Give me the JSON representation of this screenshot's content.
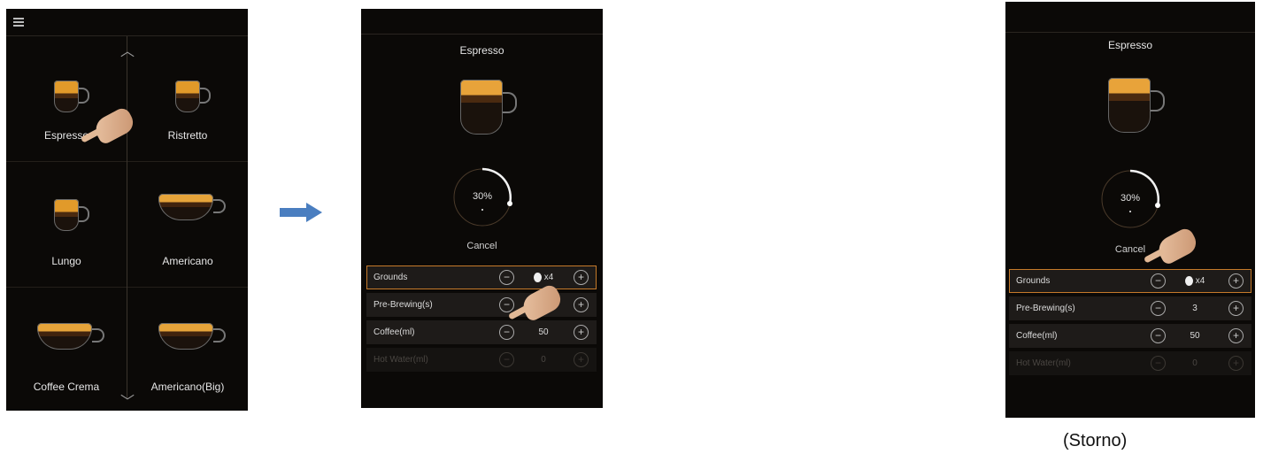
{
  "screen_menu": {
    "drinks": [
      "Espresso",
      "Ristretto",
      "Lungo",
      "Americano",
      "Coffee Crema",
      "Americano(Big)"
    ]
  },
  "screen_brewing": {
    "title": "Espresso",
    "progress_text": "30%",
    "progress_fraction": 0.3,
    "cancel_label": "Cancel",
    "rows": [
      {
        "label": "Grounds",
        "value": "x4",
        "bean": true
      },
      {
        "label": "Pre-Brewing(s)",
        "value": ""
      },
      {
        "label": "Coffee(ml)",
        "value": "50"
      },
      {
        "label": "Hot Water(ml)",
        "value": "0"
      }
    ]
  },
  "screen_cancel": {
    "title": "Espresso",
    "progress_text": "30%",
    "cancel_label": "Cancel",
    "rows": [
      {
        "label": "Grounds",
        "value": "x4",
        "bean": true
      },
      {
        "label": "Pre-Brewing(s)",
        "value": "3"
      },
      {
        "label": "Coffee(ml)",
        "value": "50"
      },
      {
        "label": "Hot Water(ml)",
        "value": "0"
      }
    ]
  },
  "controls": {
    "minus": "−",
    "plus": "+"
  },
  "icons": {
    "menu": "menu-icon",
    "up": "chevron-up-icon",
    "down": "chevron-down-icon",
    "arrow": "right-arrow-icon",
    "hand": "pointing-hand-icon"
  },
  "colors": {
    "screen_bg": "#0b0907",
    "accent": "#c57a2a",
    "arrow": "#4a7ec0"
  },
  "caption": "(Storno)"
}
